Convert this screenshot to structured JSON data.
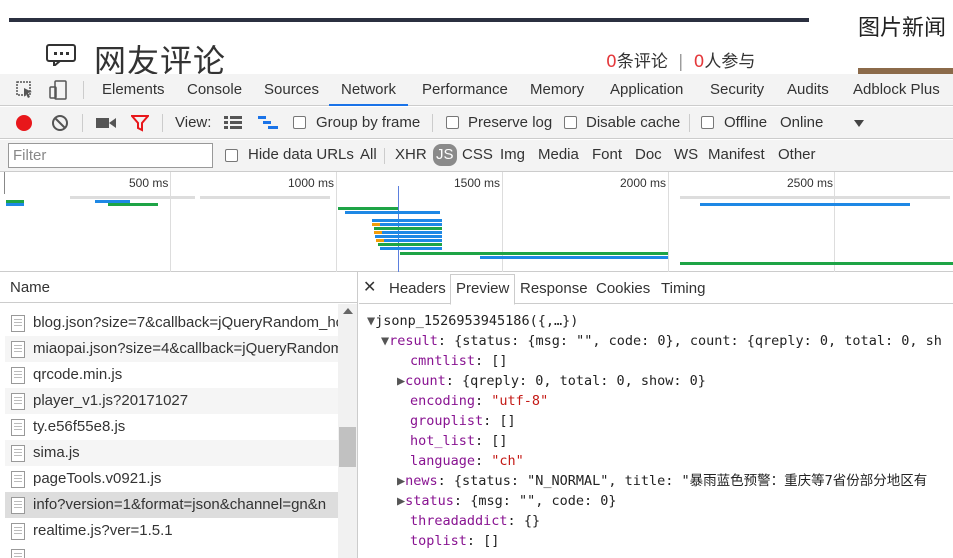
{
  "page": {
    "comment_title": "网友评论",
    "comment_count": "0",
    "comment_count_label": "条评论",
    "participant_count": "0",
    "participant_label": "人参与",
    "separator": "|",
    "side_title": "图片新闻"
  },
  "devtools": {
    "tabs": [
      "Elements",
      "Console",
      "Sources",
      "Network",
      "Performance",
      "Memory",
      "Application",
      "Security",
      "Audits",
      "Adblock Plus"
    ],
    "active_tab": "Network",
    "toolbar": {
      "view_label": "View:",
      "group_by_frame": "Group by frame",
      "preserve_log": "Preserve log",
      "disable_cache": "Disable cache",
      "offline": "Offline",
      "online": "Online"
    },
    "filter": {
      "placeholder": "Filter",
      "hide_data_urls": "Hide data URLs",
      "types": [
        "All",
        "XHR",
        "JS",
        "CSS",
        "Img",
        "Media",
        "Font",
        "Doc",
        "WS",
        "Manifest",
        "Other"
      ],
      "active_type": "JS"
    },
    "timeline_ticks": [
      "500 ms",
      "1000 ms",
      "1500 ms",
      "2000 ms",
      "2500 ms"
    ],
    "list": {
      "header": "Name",
      "rows": [
        "blog.json?size=7&callback=jQueryRandom_hc",
        "miaopai.json?size=4&callback=jQueryRandom",
        "qrcode.min.js",
        "player_v1.js?20171027",
        "ty.e56f55e8.js",
        "sima.js",
        "pageTools.v0921.js",
        "info?version=1&format=json&channel=gn&n",
        "realtime.js?ver=1.5.1"
      ]
    },
    "detail_tabs": [
      "Headers",
      "Preview",
      "Response",
      "Cookies",
      "Timing"
    ],
    "active_detail_tab": "Preview",
    "preview": {
      "root": "jsonp_1526953945186({,…})",
      "result_line": "result: {status: {msg: \"\", code: 0}, count: {qreply: 0, total: 0, sh",
      "lines": [
        {
          "key": "cmntlist",
          "value": "[]",
          "expandable": false
        },
        {
          "key": "count",
          "value": "{qreply: 0, total: 0, show: 0}",
          "expandable": true
        },
        {
          "key": "encoding",
          "value": "\"utf-8\"",
          "expandable": false,
          "string": true
        },
        {
          "key": "grouplist",
          "value": "[]",
          "expandable": false
        },
        {
          "key": "hot_list",
          "value": "[]",
          "expandable": false
        },
        {
          "key": "language",
          "value": "\"ch\"",
          "expandable": false,
          "string": true
        },
        {
          "key": "news",
          "value": "{status: \"N_NORMAL\", title: \"暴雨蓝色预警：重庆等7省份部分地区有",
          "expandable": true
        },
        {
          "key": "status",
          "value": "{msg: \"\", code: 0}",
          "expandable": true
        },
        {
          "key": "threadaddict",
          "value": "{}",
          "expandable": false
        },
        {
          "key": "toplist",
          "value": "[]",
          "expandable": false
        }
      ]
    }
  }
}
